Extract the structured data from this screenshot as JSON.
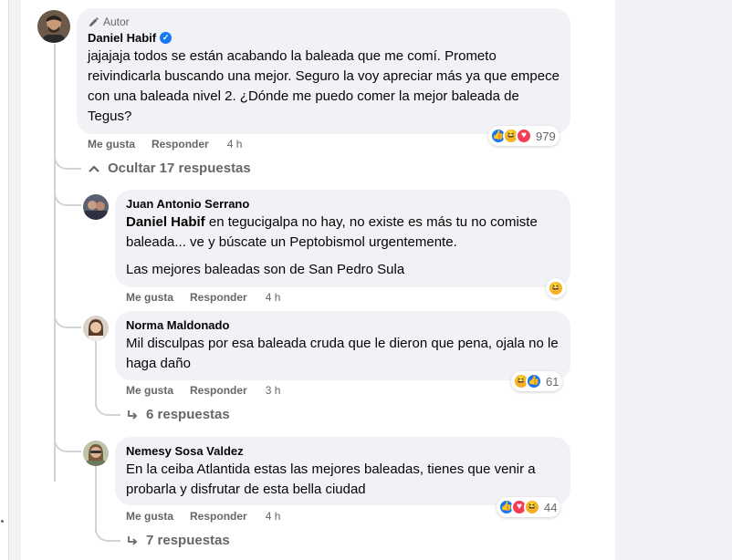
{
  "main_comment": {
    "author_tag": "Autor",
    "name": "Daniel Habif",
    "text": "jajajaja todos se están acabando la baleada que me comí. Prometo reivindicarla buscando una mejor. Seguro la voy apreciar más ya que empece con una baleada nivel 2. ¿Dónde me puedo comer la mejor baleada de Tegus?",
    "like_label": "Me gusta",
    "reply_label": "Responder",
    "time": "4 h",
    "reaction_count": "979",
    "reaction_icons": [
      "like-icon",
      "haha-icon",
      "love-icon"
    ]
  },
  "hide_replies_label": "Ocultar 17 respuestas",
  "replies": [
    {
      "name": "Juan Antonio Serrano",
      "mention": "Daniel Habif",
      "text_after_mention": " en tegucigalpa no hay, no existe es más tu no comiste baleada... ve y búscate un Peptobismol urgentemente.",
      "text_second": "Las mejores baleadas son de San Pedro Sula",
      "like_label": "Me gusta",
      "reply_label": "Responder",
      "time": "4 h",
      "reaction_icons": [
        "haha-icon"
      ]
    },
    {
      "name": "Norma Maldonado",
      "text": "Mil disculpas por esa baleada cruda que le dieron que pena, ojala no le haga daño",
      "like_label": "Me gusta",
      "reply_label": "Responder",
      "time": "3 h",
      "reaction_count": "61",
      "reaction_icons": [
        "haha-icon",
        "like-icon"
      ],
      "sub_replies_label": "6 respuestas"
    },
    {
      "name": "Nemesy Sosa Valdez",
      "text": "En la ceiba Atlantida estas las mejores baleadas, tienes que venir a probarla y disfrutar de esta bella ciudad",
      "like_label": "Me gusta",
      "reply_label": "Responder",
      "time": "4 h",
      "reaction_count": "44",
      "reaction_icons": [
        "like-icon",
        "love-icon",
        "haha-icon"
      ],
      "sub_replies_label": "7 respuestas"
    }
  ],
  "colors": {
    "bubble": "#f0f2f5",
    "secondary_text": "#65676b",
    "like_blue": "#1877f2",
    "haha_yellow": "#f7b125",
    "love_red": "#f33e58"
  }
}
